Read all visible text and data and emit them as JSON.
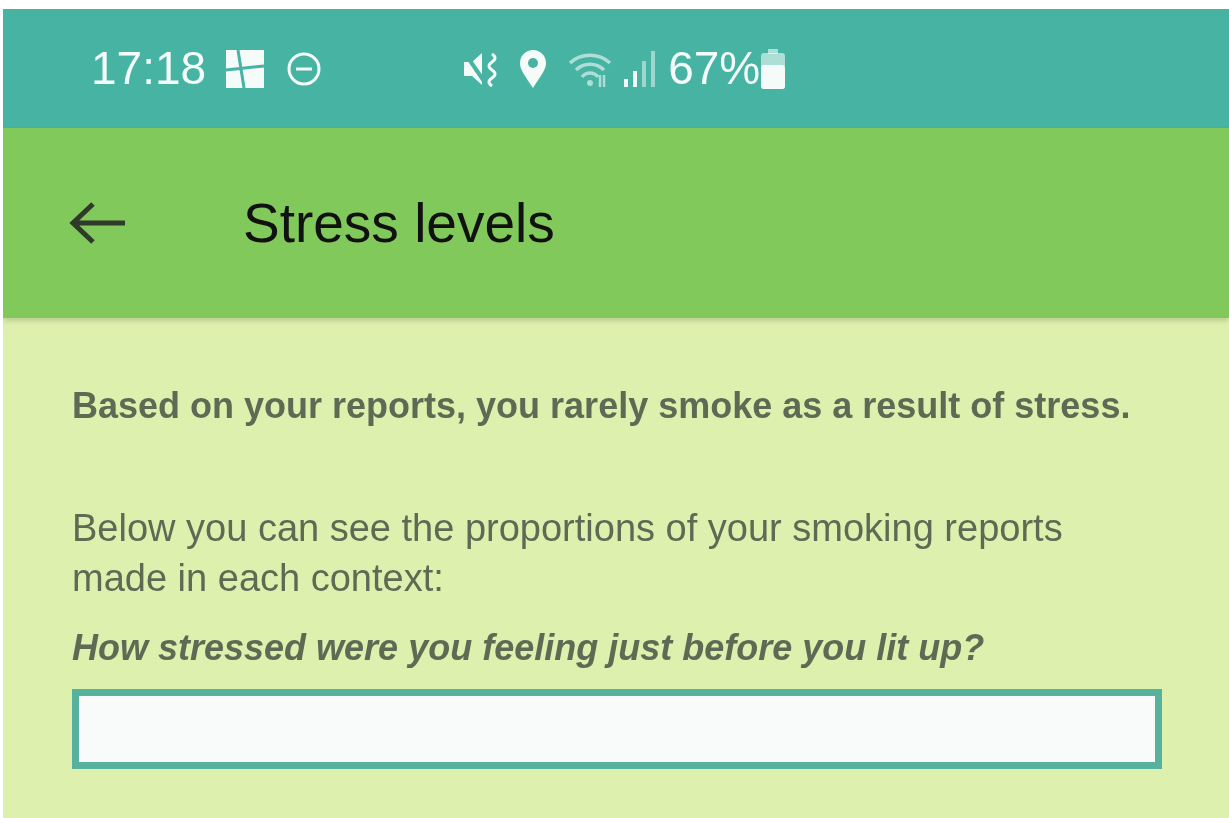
{
  "status_bar": {
    "time": "17:18",
    "battery": "67%"
  },
  "app_bar": {
    "title": "Stress levels"
  },
  "content": {
    "summary": "Based on your reports, you rarely smoke as a result of stress.",
    "intro": "Below you can see the proportions of your smoking reports made in each context:",
    "question": "How stressed were you feeling just before you lit up?"
  }
}
